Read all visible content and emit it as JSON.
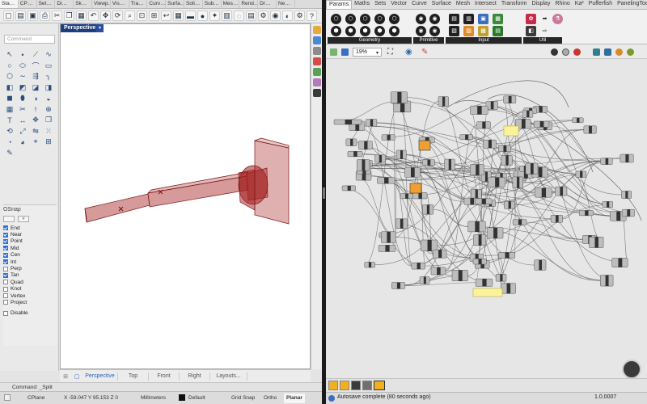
{
  "rhino": {
    "tabs": [
      "Sta…",
      "CP…",
      "Set…",
      "Di…",
      "Sk…",
      "Viewp…",
      "Vis…",
      "Tra…",
      "Curv…",
      "Surfa…",
      "Soli…",
      "Sub…",
      "Mes…",
      "Rend…",
      "Dr…",
      "Ne…"
    ],
    "command_placeholder": "Command",
    "viewport_label": "Perspective",
    "osnap": {
      "title": "OSnap",
      "items": [
        {
          "label": "End",
          "checked": true
        },
        {
          "label": "Near",
          "checked": true
        },
        {
          "label": "Point",
          "checked": true
        },
        {
          "label": "Mid",
          "checked": true
        },
        {
          "label": "Cen",
          "checked": true
        },
        {
          "label": "Int",
          "checked": true
        },
        {
          "label": "Perp",
          "checked": false
        },
        {
          "label": "Tan",
          "checked": true
        },
        {
          "label": "Quad",
          "checked": false
        },
        {
          "label": "Knot",
          "checked": false
        },
        {
          "label": "Vertex",
          "checked": false
        },
        {
          "label": "Project",
          "checked": false
        }
      ],
      "disable_label": "Disable"
    },
    "view_tabs": [
      "Perspective",
      "Top",
      "Front",
      "Right",
      "Layouts..."
    ],
    "command_line": "Command: _Split",
    "status": {
      "cplane": "CPlane",
      "coords": "X -59.047 Y 95.153 Z 0",
      "units": "Millimeters",
      "layer": "Default",
      "grid_snap": "Grid Snap",
      "ortho": "Ortho",
      "planar": "Planar"
    }
  },
  "gh": {
    "tabs": [
      "Params",
      "Maths",
      "Sets",
      "Vector",
      "Curve",
      "Surface",
      "Mesh",
      "Intersect",
      "Transform",
      "Display",
      "Rhino",
      "Ka²",
      "Pufferfish",
      "PanelingTools"
    ],
    "groups": [
      "Geometry",
      "Primitive",
      "Input",
      "Util"
    ],
    "zoom": "19%",
    "status_text": "Autosave complete (80 seconds ago)",
    "version": "1.0.0007"
  },
  "colors": {
    "accent_blue": "#1e3f7e",
    "model_red": "#a31e1e",
    "panel_yellow": "#fbf39a",
    "orange_component": "#f0a030"
  },
  "icons": [
    "new-icon",
    "open-icon",
    "save-icon",
    "print-icon",
    "cut-icon",
    "copy-icon",
    "paste-icon",
    "undo-icon",
    "pan-icon",
    "zoom-icon",
    "settings-icon",
    "eye-icon",
    "cherries-icon",
    "arrow-icon",
    "flask-icon"
  ]
}
